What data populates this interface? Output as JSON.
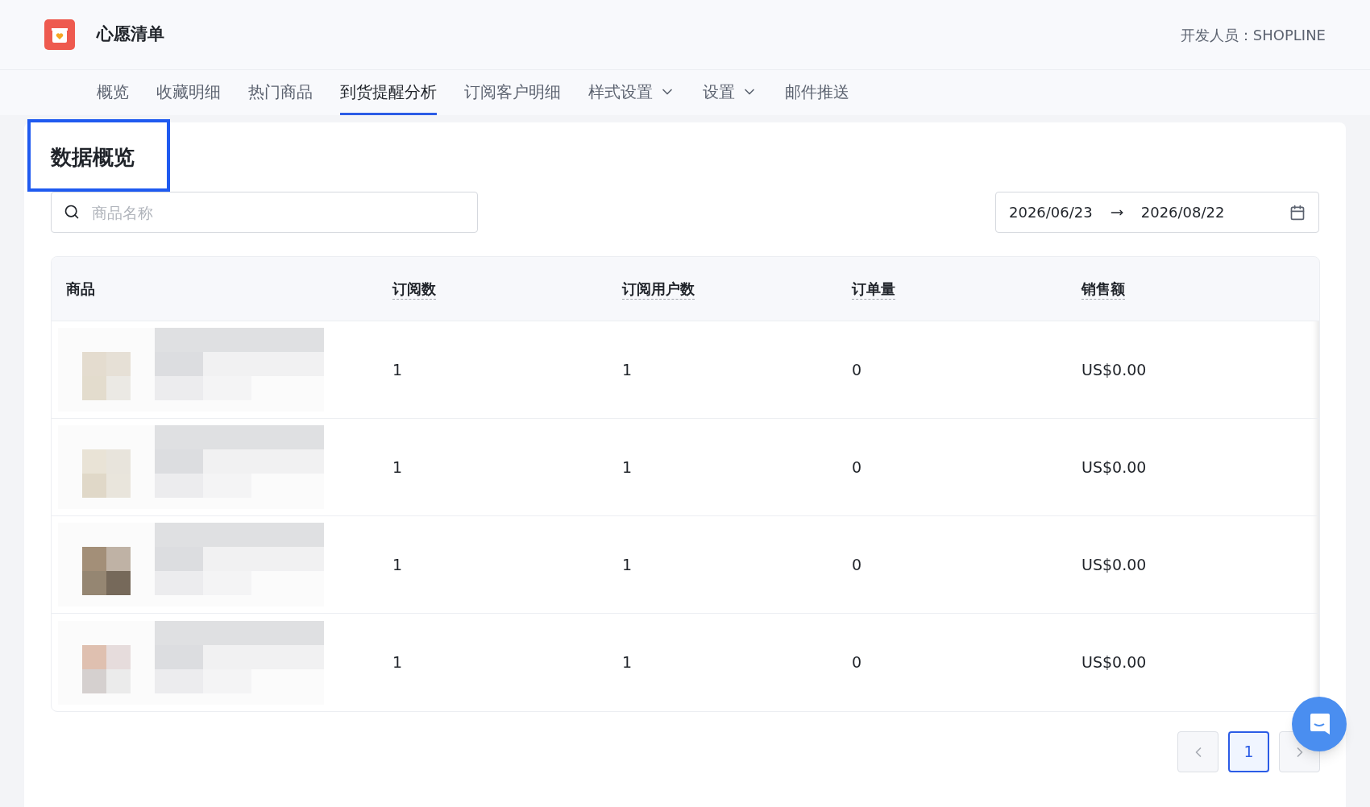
{
  "app": {
    "title": "心愿清单",
    "developer": "开发人员：SHOPLINE"
  },
  "tabs": [
    {
      "label": "概览",
      "selected": false,
      "dropdown": false
    },
    {
      "label": "收藏明细",
      "selected": false,
      "dropdown": false
    },
    {
      "label": "热门商品",
      "selected": false,
      "dropdown": false
    },
    {
      "label": "到货提醒分析",
      "selected": true,
      "dropdown": false
    },
    {
      "label": "订阅客户明细",
      "selected": false,
      "dropdown": false
    },
    {
      "label": "样式设置",
      "selected": false,
      "dropdown": true
    },
    {
      "label": "设置",
      "selected": false,
      "dropdown": true
    },
    {
      "label": "邮件推送",
      "selected": false,
      "dropdown": false
    }
  ],
  "section_title": "数据概览",
  "search": {
    "placeholder": "商品名称"
  },
  "date_range": {
    "start": "2026/06/23",
    "end": "2026/08/22"
  },
  "table": {
    "columns": [
      {
        "label": "商品",
        "hint": false
      },
      {
        "label": "订阅数",
        "hint": true
      },
      {
        "label": "订阅用户数",
        "hint": true
      },
      {
        "label": "订单量",
        "hint": true
      },
      {
        "label": "销售额",
        "hint": true
      }
    ],
    "rows": [
      {
        "cells": [
          {
            "kind": "picture"
          },
          {
            "kind": "text",
            "text": "1"
          },
          {
            "kind": "text",
            "text": "1"
          },
          {
            "kind": "text",
            "text": "0"
          },
          {
            "kind": "text",
            "text": "US$0.00"
          }
        ]
      },
      {
        "cells": [
          {
            "kind": "picture"
          },
          {
            "kind": "text",
            "text": "1"
          },
          {
            "kind": "text",
            "text": "1"
          },
          {
            "kind": "text",
            "text": "0"
          },
          {
            "kind": "text",
            "text": "US$0.00"
          }
        ]
      },
      {
        "cells": [
          {
            "kind": "picture"
          },
          {
            "kind": "text",
            "text": "1"
          },
          {
            "kind": "text",
            "text": "1"
          },
          {
            "kind": "text",
            "text": "0"
          },
          {
            "kind": "text",
            "text": "US$0.00"
          }
        ]
      },
      {
        "cells": [
          {
            "kind": "picture"
          },
          {
            "kind": "text",
            "text": "1"
          },
          {
            "kind": "text",
            "text": "1"
          },
          {
            "kind": "text",
            "text": "0"
          },
          {
            "kind": "text",
            "text": "US$0.00"
          }
        ]
      }
    ]
  },
  "pagination": {
    "pages": [
      {
        "label": "1",
        "selected": true
      }
    ]
  }
}
